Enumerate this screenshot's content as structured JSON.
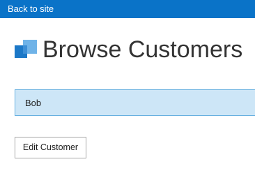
{
  "topbar": {
    "back_label": "Back to site",
    "color": "#0a73c8"
  },
  "header": {
    "title": "Browse Customers",
    "logo_icon": "squares-logo-icon"
  },
  "customers": {
    "items": [
      {
        "name": "Bob",
        "selected": true
      }
    ],
    "selected_color": "#cde6f7"
  },
  "actions": {
    "edit_label": "Edit Customer"
  }
}
